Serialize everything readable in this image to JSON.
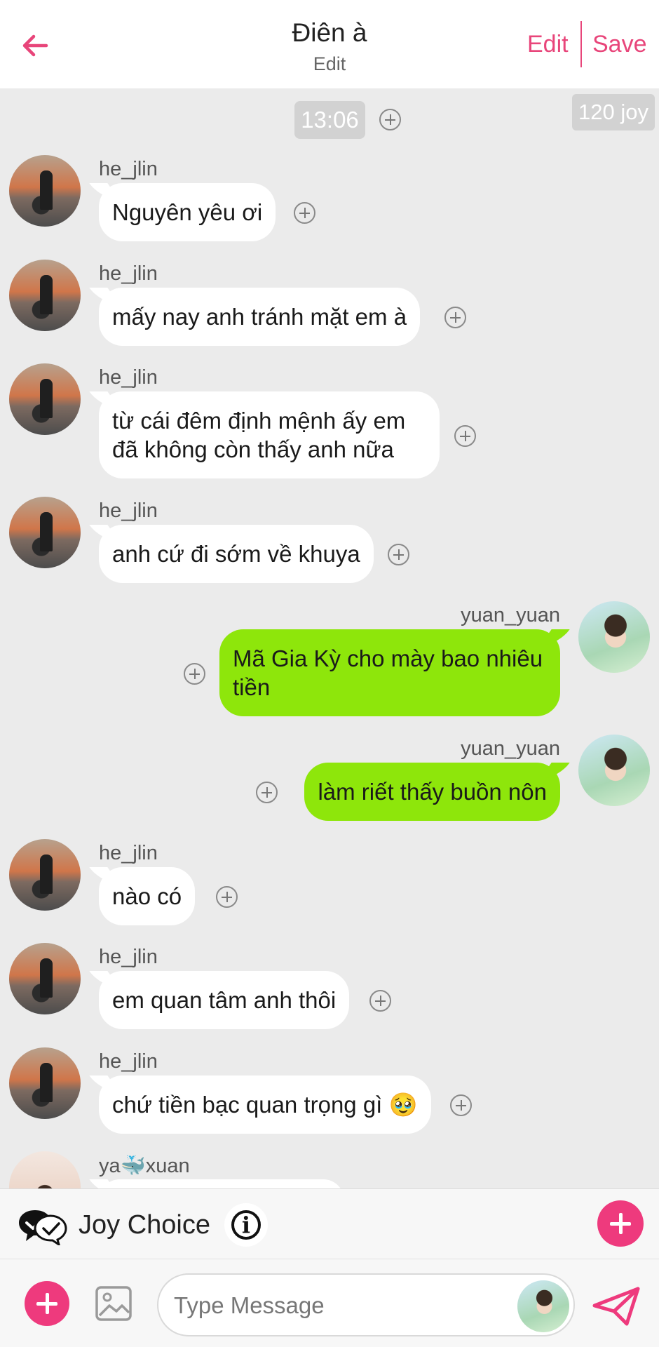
{
  "header": {
    "title": "Điên à",
    "subtitle": "Edit",
    "edit_label": "Edit",
    "save_label": "Save",
    "accent_color": "#e8457a"
  },
  "chat": {
    "time": "13:06",
    "joy_badge": "120 joy",
    "messages": [
      {
        "sender": "he_jlin",
        "side": "left",
        "text": "Nguyên yêu ơi"
      },
      {
        "sender": "he_jlin",
        "side": "left",
        "text": "mấy nay anh tránh mặt em à"
      },
      {
        "sender": "he_jlin",
        "side": "left",
        "text": "từ cái đêm định mệnh ấy em đã không còn thấy anh nữa"
      },
      {
        "sender": "he_jlin",
        "side": "left",
        "text": "anh cứ đi sớm về khuya"
      },
      {
        "sender": "yuan_yuan",
        "side": "right",
        "text": "Mã Gia Kỳ cho mày bao nhiêu tiền"
      },
      {
        "sender": "yuan_yuan",
        "side": "right",
        "text": "làm riết thấy buồn nôn"
      },
      {
        "sender": "he_jlin",
        "side": "left",
        "text": "nào có"
      },
      {
        "sender": "he_jlin",
        "side": "left",
        "text": "em quan tâm anh thôi"
      },
      {
        "sender": "he_jlin",
        "side": "left",
        "text": "chứ tiền bạc quan trọng gì 🥹"
      },
      {
        "sender": "ya🐳xuan",
        "side": "left",
        "text": ""
      }
    ],
    "left_bubble_color": "#ffffff",
    "right_bubble_color": "#8ee60b"
  },
  "joy_choice": {
    "label": "Joy Choice",
    "info_icon": "i",
    "add_button_color": "#ee3a7d"
  },
  "composer": {
    "placeholder": "Type Message",
    "value": ""
  }
}
